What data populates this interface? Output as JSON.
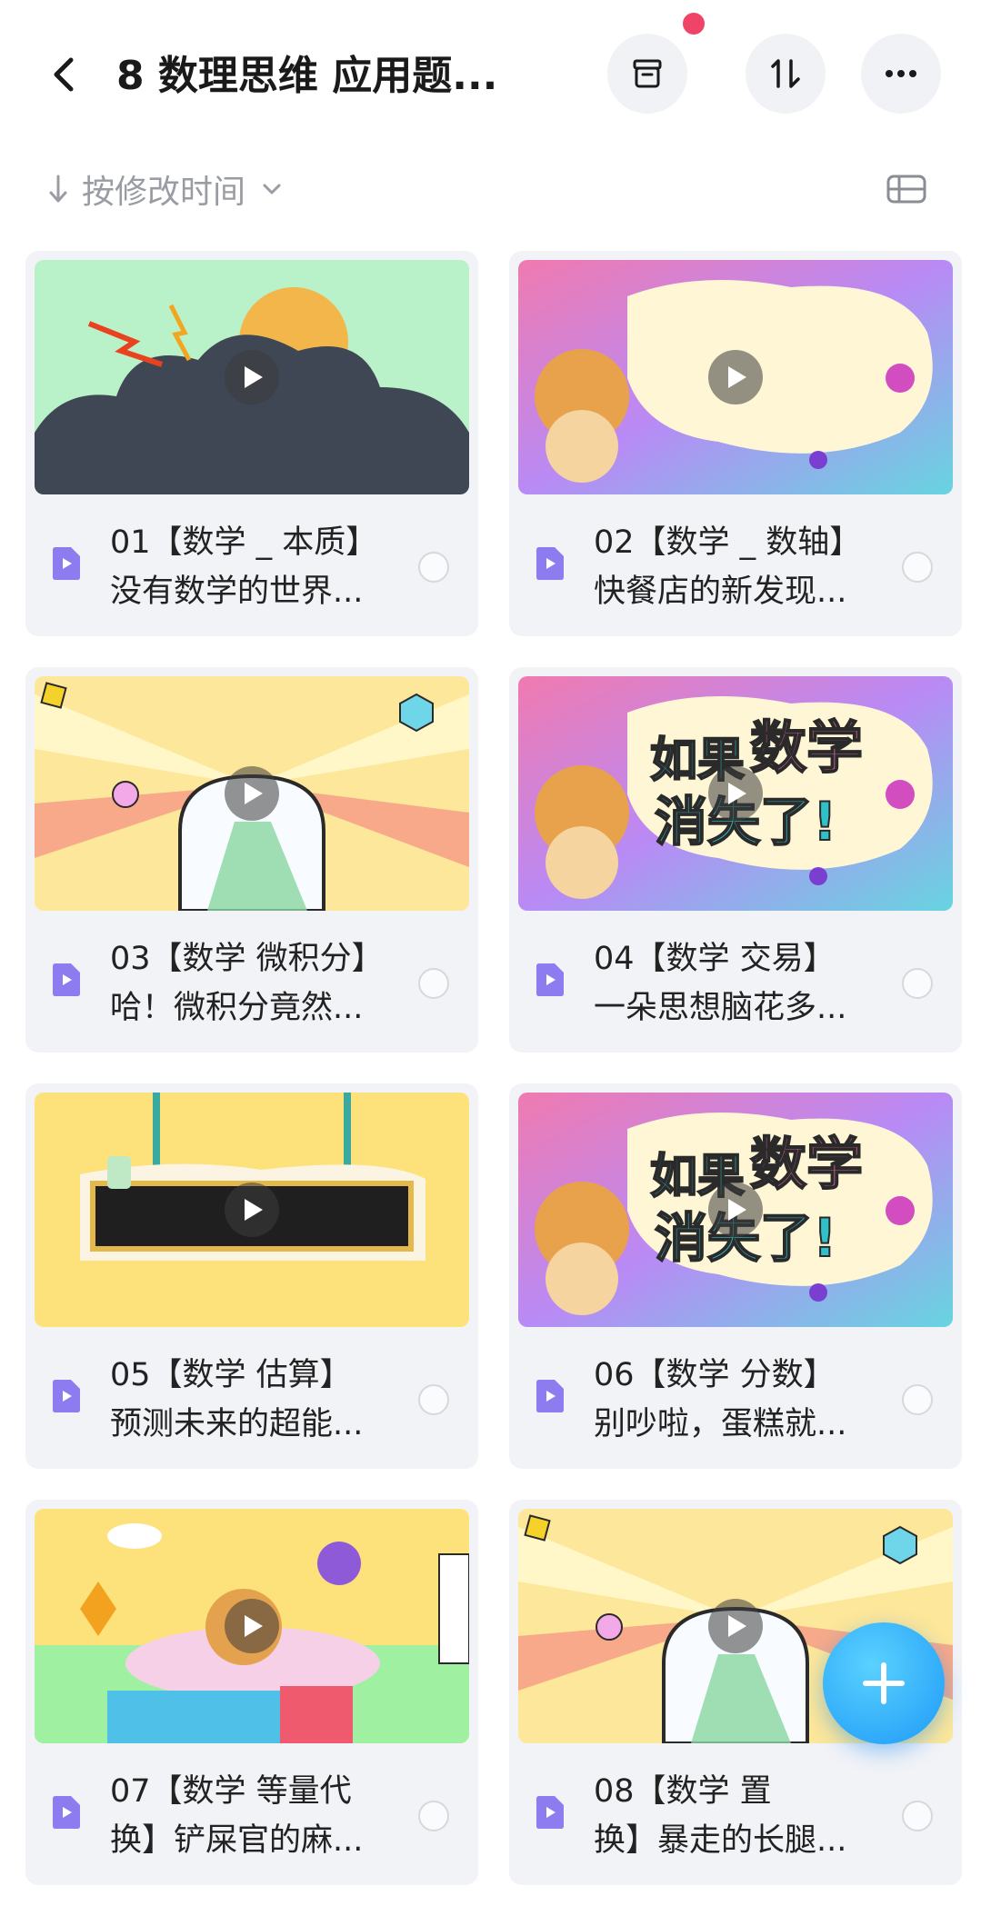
{
  "header": {
    "title": "8 数理思维 应用题...",
    "back_icon": "chevron-left-icon",
    "archive_icon": "archive-box-icon",
    "sort_icon": "sort-updown-icon",
    "more_icon": "more-horizontal-icon",
    "notification_dot_color": "#f04368"
  },
  "sortbar": {
    "label": "按修改时间",
    "arrow_icon": "arrow-down-icon",
    "dropdown_icon": "chevron-down-icon",
    "view_icon": "list-view-icon"
  },
  "items": [
    {
      "title": "01【数学 _ 本质】\n没有数学的世界...",
      "theme": "cloud"
    },
    {
      "title": "02【数学 _ 数轴】\n快餐店的新发现...",
      "theme": "cartoon"
    },
    {
      "title": "03【数学 微积分】\n哈！微积分竟然...",
      "theme": "rays"
    },
    {
      "title": "04【数学 交易】\n一朵思想脑花多...",
      "theme": "cartoon-text"
    },
    {
      "title": "05【数学 估算】\n预测未来的超能...",
      "theme": "sign"
    },
    {
      "title": "06【数学 分数】\n别吵啦，蛋糕就...",
      "theme": "cartoon-text"
    },
    {
      "title": "07【数学 等量代\n换】铲屎官的麻...",
      "theme": "room"
    },
    {
      "title": "08【数学 置\n换】暴走的长腿...",
      "theme": "rays"
    }
  ],
  "thumb_texts": {
    "cartoon_text_line1": "如果数学",
    "cartoon_text_line2": "消失了!"
  },
  "fab": {
    "icon": "plus-icon",
    "color": "#1e9af7"
  },
  "colors": {
    "accent": "#1e9af7",
    "file_icon": "#8c7cf0",
    "card_bg": "#f2f3f7"
  }
}
